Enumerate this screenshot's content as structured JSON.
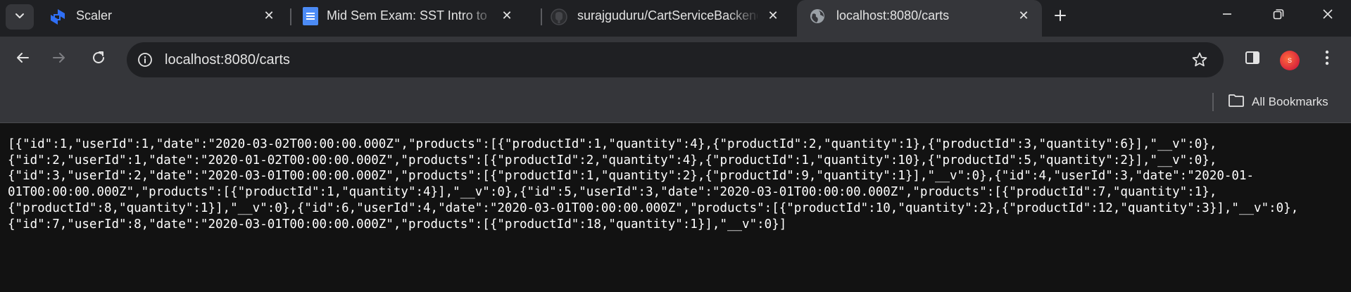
{
  "tabs": [
    {
      "title": "Scaler",
      "favicon": "scaler-icon",
      "active": false
    },
    {
      "title": "Mid Sem Exam: SST Intro to Backend",
      "favicon": "google-docs-icon",
      "active": false
    },
    {
      "title": "surajguduru/CartServiceBackend",
      "favicon": "github-icon",
      "active": false
    },
    {
      "title": "localhost:8080/carts",
      "favicon": "globe-icon",
      "active": true
    }
  ],
  "toolbar": {
    "url": "localhost:8080/carts"
  },
  "profile": {
    "initial": "S"
  },
  "bookmarks": {
    "all_label": "All Bookmarks"
  },
  "page": {
    "body_text": "[{\"id\":1,\"userId\":1,\"date\":\"2020-03-02T00:00:00.000Z\",\"products\":[{\"productId\":1,\"quantity\":4},{\"productId\":2,\"quantity\":1},{\"productId\":3,\"quantity\":6}],\"__v\":0},\n{\"id\":2,\"userId\":1,\"date\":\"2020-01-02T00:00:00.000Z\",\"products\":[{\"productId\":2,\"quantity\":4},{\"productId\":1,\"quantity\":10},{\"productId\":5,\"quantity\":2}],\"__v\":0},\n{\"id\":3,\"userId\":2,\"date\":\"2020-03-01T00:00:00.000Z\",\"products\":[{\"productId\":1,\"quantity\":2},{\"productId\":9,\"quantity\":1}],\"__v\":0},{\"id\":4,\"userId\":3,\"date\":\"2020-01-\n01T00:00:00.000Z\",\"products\":[{\"productId\":1,\"quantity\":4}],\"__v\":0},{\"id\":5,\"userId\":3,\"date\":\"2020-03-01T00:00:00.000Z\",\"products\":[{\"productId\":7,\"quantity\":1},\n{\"productId\":8,\"quantity\":1}],\"__v\":0},{\"id\":6,\"userId\":4,\"date\":\"2020-03-01T00:00:00.000Z\",\"products\":[{\"productId\":10,\"quantity\":2},{\"productId\":12,\"quantity\":3}],\"__v\":0},\n{\"id\":7,\"userId\":8,\"date\":\"2020-03-01T00:00:00.000Z\",\"products\":[{\"productId\":18,\"quantity\":1}],\"__v\":0}]"
  },
  "colors": {
    "tabstrip_bg": "#1f2023",
    "toolbar_bg": "#35363a",
    "omnibox_bg": "#1f2023",
    "page_bg": "#121212",
    "text": "#e3e3e3",
    "scaler_blue": "#2f6ff5",
    "docs_blue": "#4c8bf5"
  }
}
